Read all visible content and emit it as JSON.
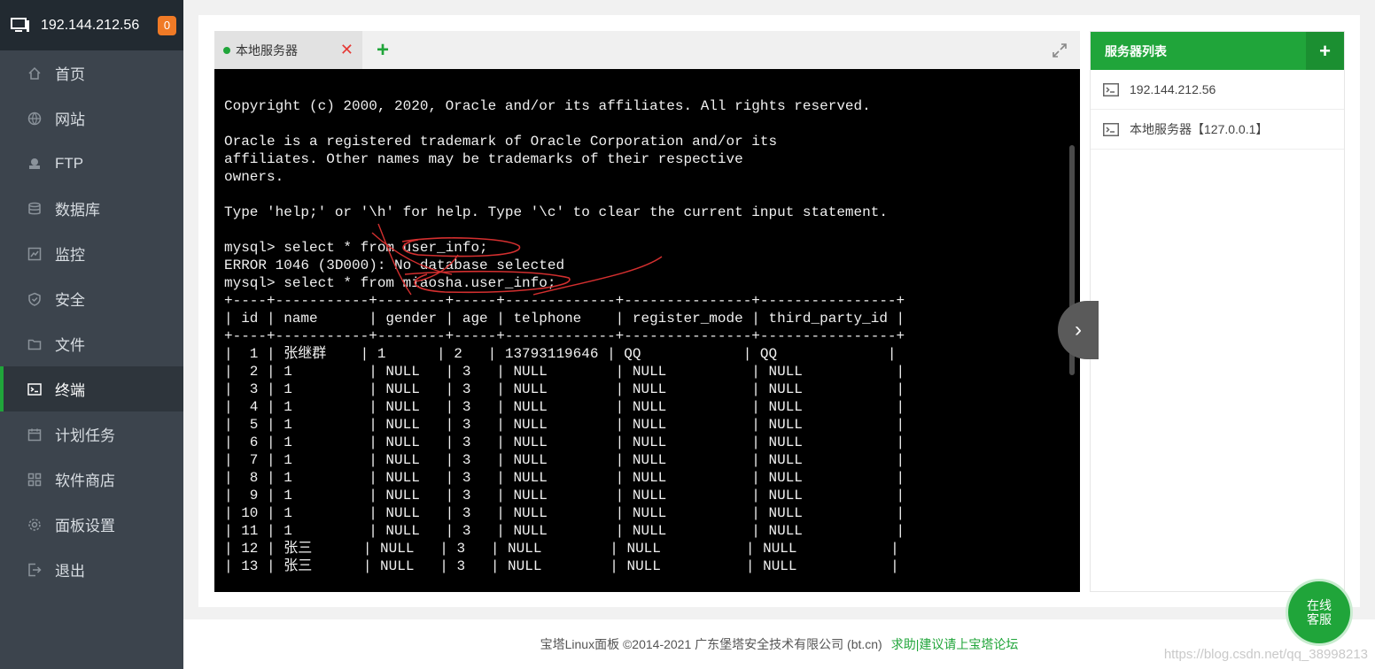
{
  "sidebar": {
    "host": "192.144.212.56",
    "badge": "0",
    "items": [
      {
        "label": "首页",
        "icon": "home-icon"
      },
      {
        "label": "网站",
        "icon": "globe-icon"
      },
      {
        "label": "FTP",
        "icon": "ftp-icon"
      },
      {
        "label": "数据库",
        "icon": "database-icon"
      },
      {
        "label": "监控",
        "icon": "monitor-icon"
      },
      {
        "label": "安全",
        "icon": "shield-icon"
      },
      {
        "label": "文件",
        "icon": "folder-icon"
      },
      {
        "label": "终端",
        "icon": "terminal-icon",
        "active": true
      },
      {
        "label": "计划任务",
        "icon": "calendar-icon"
      },
      {
        "label": "软件商店",
        "icon": "apps-icon"
      },
      {
        "label": "面板设置",
        "icon": "settings-icon"
      },
      {
        "label": "退出",
        "icon": "logout-icon"
      }
    ]
  },
  "terminal": {
    "tab_label": "本地服务器",
    "close_symbol": "✕",
    "add_symbol": "+",
    "lines": [
      "Copyright (c) 2000, 2020, Oracle and/or its affiliates. All rights reserved.",
      "",
      "Oracle is a registered trademark of Oracle Corporation and/or its",
      "affiliates. Other names may be trademarks of their respective",
      "owners.",
      "",
      "Type 'help;' or '\\h' for help. Type '\\c' to clear the current input statement.",
      "",
      "mysql> select * from user_info;",
      "ERROR 1046 (3D000): No database selected",
      "mysql> select * from miaosha.user_info;",
      "+----+-----------+--------+-----+-------------+---------------+----------------+",
      "| id | name      | gender | age | telphone    | register_mode | third_party_id |",
      "+----+-----------+--------+-----+-------------+---------------+----------------+",
      "|  1 | 张继群    | 1      | 2   | 13793119646 | QQ            | QQ             |",
      "|  2 | 1         | NULL   | 3   | NULL        | NULL          | NULL           |",
      "|  3 | 1         | NULL   | 3   | NULL        | NULL          | NULL           |",
      "|  4 | 1         | NULL   | 3   | NULL        | NULL          | NULL           |",
      "|  5 | 1         | NULL   | 3   | NULL        | NULL          | NULL           |",
      "|  6 | 1         | NULL   | 3   | NULL        | NULL          | NULL           |",
      "|  7 | 1         | NULL   | 3   | NULL        | NULL          | NULL           |",
      "|  8 | 1         | NULL   | 3   | NULL        | NULL          | NULL           |",
      "|  9 | 1         | NULL   | 3   | NULL        | NULL          | NULL           |",
      "| 10 | 1         | NULL   | 3   | NULL        | NULL          | NULL           |",
      "| 11 | 1         | NULL   | 3   | NULL        | NULL          | NULL           |",
      "| 12 | 张三      | NULL   | 3   | NULL        | NULL          | NULL           |",
      "| 13 | 张三      | NULL   | 3   | NULL        | NULL          | NULL           |"
    ]
  },
  "server_list": {
    "title": "服务器列表",
    "add_symbol": "+",
    "items": [
      "192.144.212.56",
      "本地服务器【127.0.0.1】"
    ]
  },
  "footer": {
    "copyright": "宝塔Linux面板 ©2014-2021 广东堡塔安全技术有限公司 (bt.cn)",
    "link": "求助|建议请上宝塔论坛"
  },
  "chat": {
    "line1": "在线",
    "line2": "客服"
  },
  "watermark": "https://blog.csdn.net/qq_38998213",
  "colors": {
    "accent": "#20a53a",
    "sidebar": "#3c444d",
    "badge": "#f07a26",
    "terminal_bg": "#000000"
  }
}
